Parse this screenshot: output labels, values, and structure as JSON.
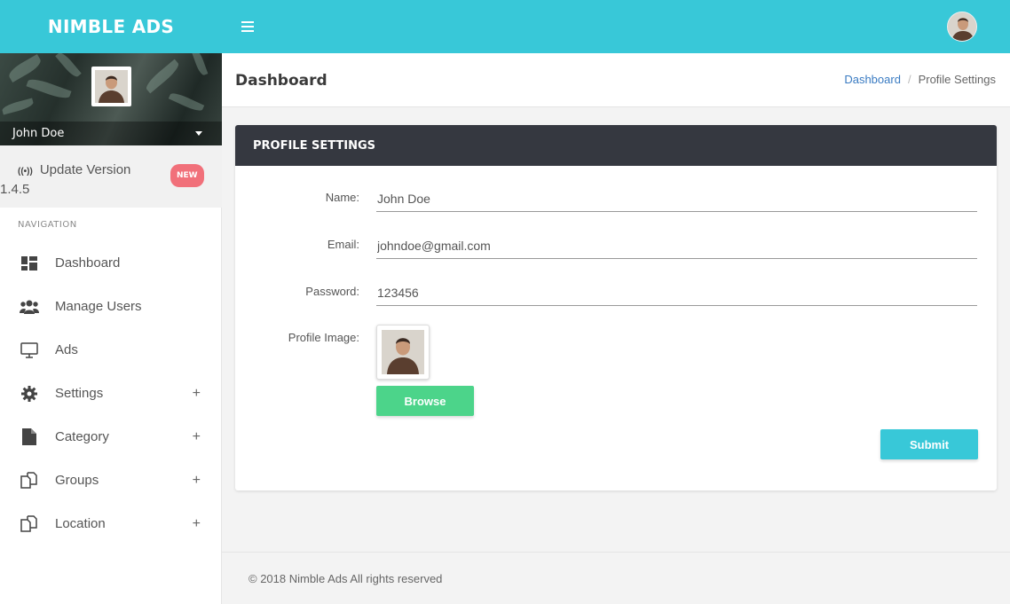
{
  "header": {
    "brand": "NIMBLE ADS"
  },
  "sidebar": {
    "user_name": "John Doe",
    "update": {
      "icon_text": "((•))",
      "label": "Update Version",
      "version": "1.4.5",
      "badge": "NEW"
    },
    "nav_title": "NAVIGATION",
    "items": [
      {
        "label": "Dashboard",
        "icon": "dashboard-icon",
        "expandable": false
      },
      {
        "label": "Manage Users",
        "icon": "users-icon",
        "expandable": false
      },
      {
        "label": "Ads",
        "icon": "monitor-icon",
        "expandable": false
      },
      {
        "label": "Settings",
        "icon": "gear-icon",
        "expandable": true
      },
      {
        "label": "Category",
        "icon": "file-icon",
        "expandable": true
      },
      {
        "label": "Groups",
        "icon": "copy-icon",
        "expandable": true
      },
      {
        "label": "Location",
        "icon": "copy-icon",
        "expandable": true
      }
    ],
    "expand_symbol": "+"
  },
  "page": {
    "title": "Dashboard",
    "breadcrumb": {
      "home": "Dashboard",
      "separator": "/",
      "current": "Profile Settings"
    }
  },
  "form": {
    "card_title": "PROFILE SETTINGS",
    "name_label": "Name:",
    "name_value": "John Doe",
    "email_label": "Email:",
    "email_value": "johndoe@gmail.com",
    "password_label": "Password:",
    "password_value": "123456",
    "image_label": "Profile Image:",
    "browse_label": "Browse",
    "submit_label": "Submit"
  },
  "footer": {
    "text": "© 2018 Nimble Ads All rights reserved"
  },
  "colors": {
    "accent": "#38c8d8",
    "browse": "#4cd48a",
    "card_header": "#353840",
    "badge": "#f1707a",
    "link": "#3a7bc2"
  }
}
